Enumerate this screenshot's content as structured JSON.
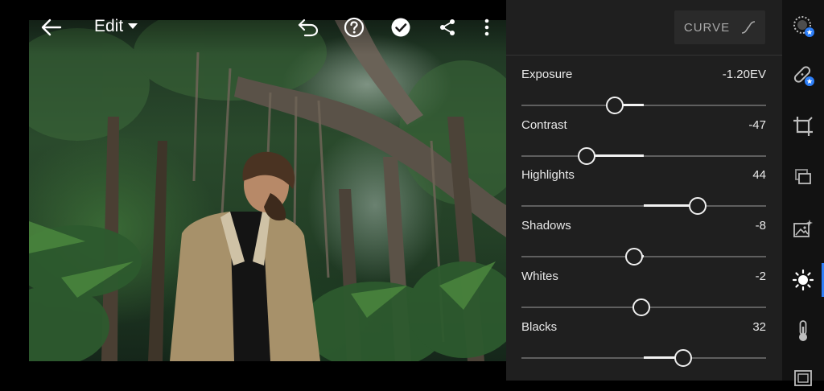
{
  "toolbar": {
    "mode_label": "Edit",
    "icons": [
      "back-arrow-icon",
      "chevron-down-icon",
      "undo-icon",
      "help-icon",
      "checkmark-icon",
      "share-icon",
      "more-vertical-icon"
    ]
  },
  "panel": {
    "curve_label": "CURVE",
    "sliders": [
      {
        "label": "Exposure",
        "value": "-1.20EV",
        "level": -0.24
      },
      {
        "label": "Contrast",
        "value": "-47",
        "level": -0.47
      },
      {
        "label": "Highlights",
        "value": "44",
        "level": 0.44
      },
      {
        "label": "Shadows",
        "value": "-8",
        "level": -0.08
      },
      {
        "label": "Whites",
        "value": "-2",
        "level": -0.02
      },
      {
        "label": "Blacks",
        "value": "32",
        "level": 0.32
      }
    ]
  },
  "rail": {
    "tools": [
      "presets-icon",
      "healing-icon",
      "crop-icon",
      "versions-icon",
      "auto-enhance-icon",
      "light-icon",
      "color-temperature-icon",
      "effects-icon"
    ],
    "active_tool": "light-icon"
  },
  "colors": {
    "accent": "#2d7ff9",
    "panel_bg": "#1f1f1f",
    "rail_bg": "#121212",
    "slider_fill": "#f2f2f2",
    "slider_track": "#5f5f5f"
  }
}
